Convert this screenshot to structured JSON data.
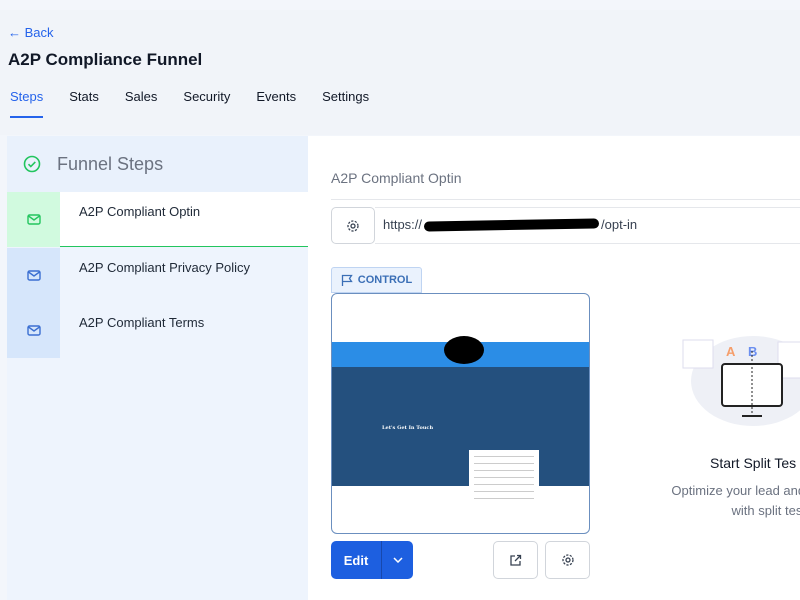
{
  "header": {
    "back": "← Back",
    "title": "A2P Compliance Funnel"
  },
  "tabs": [
    {
      "label": "Steps",
      "active": true
    },
    {
      "label": "Stats"
    },
    {
      "label": "Sales"
    },
    {
      "label": "Security"
    },
    {
      "label": "Events"
    },
    {
      "label": "Settings"
    }
  ],
  "sidebar": {
    "title": "Funnel Steps",
    "steps": [
      {
        "label": "A2P Compliant Optin",
        "icon": "mail-icon",
        "active": true
      },
      {
        "label": "A2P Compliant Privacy Policy",
        "icon": "mail-icon"
      },
      {
        "label": "A2P Compliant Terms",
        "icon": "mail-icon"
      }
    ]
  },
  "main": {
    "page_title": "A2P Compliant Optin",
    "url_prefix": "https://",
    "url_suffix": "/opt-in",
    "control_label": "CONTROL",
    "preview_heading": "Let's Get In Touch",
    "edit_label": "Edit",
    "split": {
      "title": "Start Split Tes",
      "desc_line1": "Optimize your lead and sale",
      "desc_line2": "with split tests"
    }
  },
  "colors": {
    "accent": "#2563eb",
    "success": "#22c55e"
  }
}
